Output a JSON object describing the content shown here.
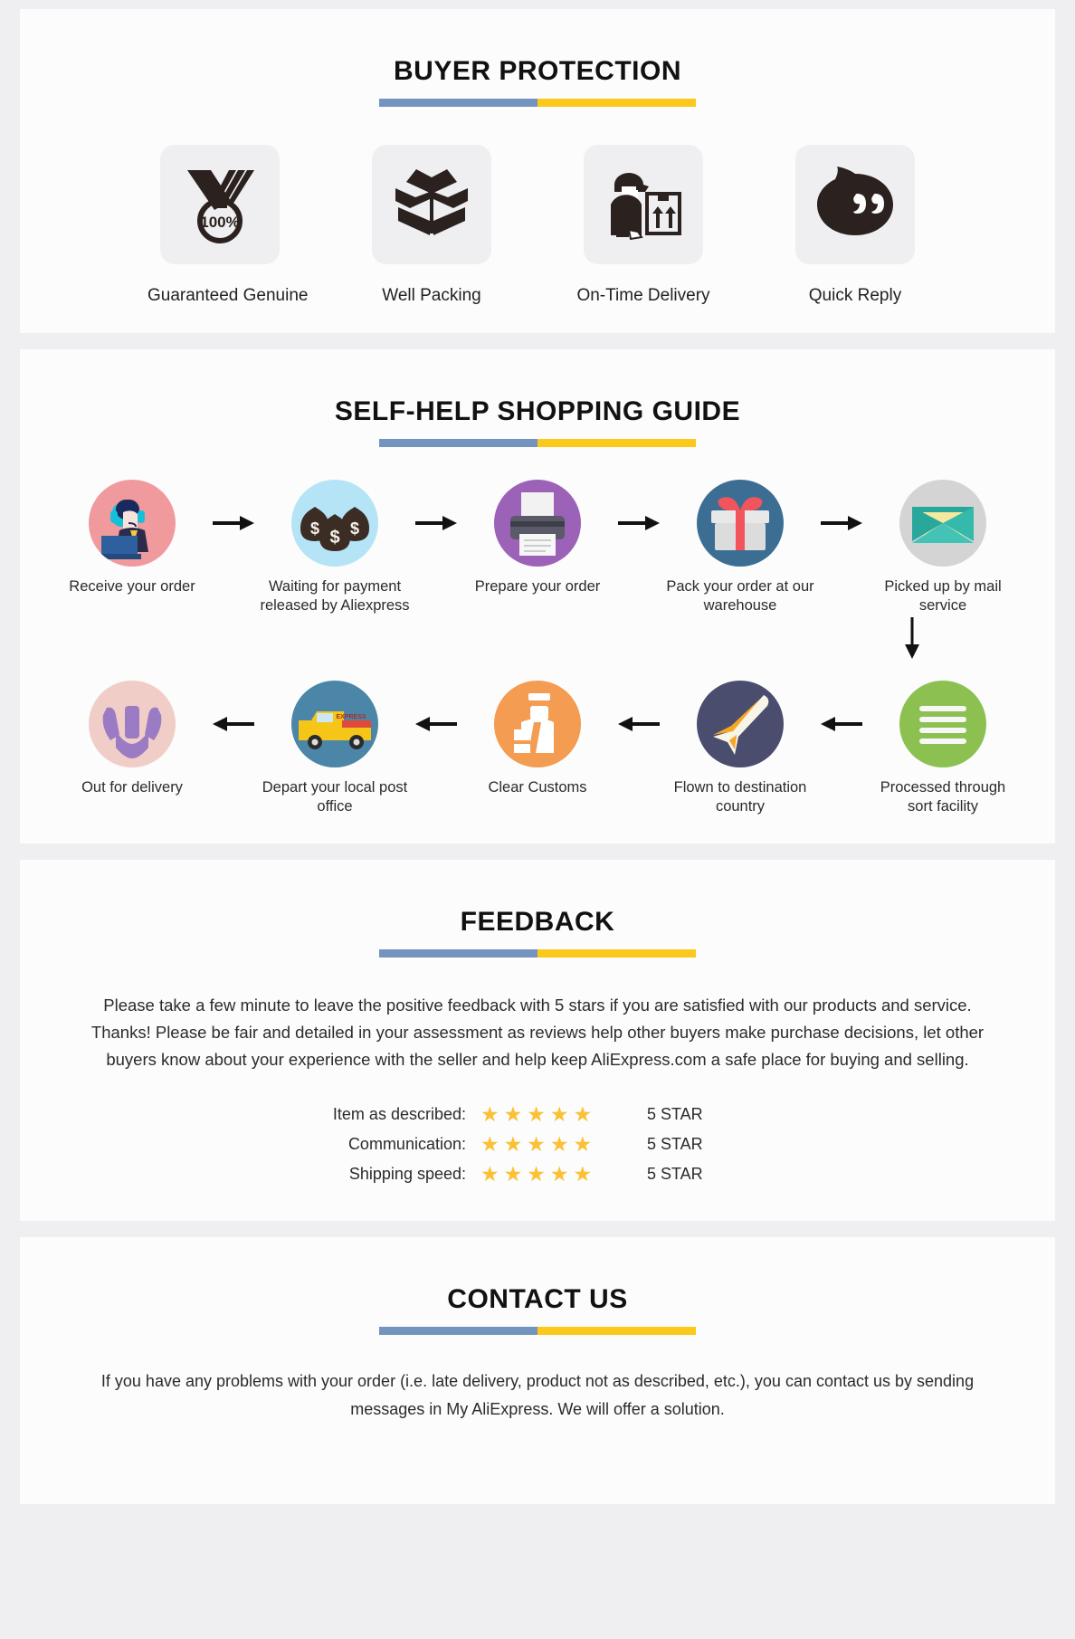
{
  "buyer_protection": {
    "title": "BUYER PROTECTION",
    "items": [
      {
        "label": "Guaranteed Genuine",
        "icon": "medal-100-percent-icon",
        "badge": "100%"
      },
      {
        "label": "Well Packing",
        "icon": "open-box-icon"
      },
      {
        "label": "On-Time Delivery",
        "icon": "delivery-person-box-icon"
      },
      {
        "label": "Quick Reply",
        "icon": "speech-bubble-icon"
      }
    ]
  },
  "shopping_guide": {
    "title": "SELF-HELP SHOPPING GUIDE",
    "row1": [
      {
        "label": "Receive your order",
        "icon": "support-agent-icon",
        "circle": "#f09a9d"
      },
      {
        "label": "Waiting for payment released by Aliexpress",
        "icon": "money-bags-icon",
        "circle": "#b6e4f7"
      },
      {
        "label": "Prepare your order",
        "icon": "printer-icon",
        "circle": "#9b62b8"
      },
      {
        "label": "Pack your order at our warehouse",
        "icon": "gift-box-icon",
        "circle": "#3c6e94"
      },
      {
        "label": "Picked up by mail service",
        "icon": "envelope-icon",
        "circle": "#d4d4d4"
      }
    ],
    "row2": [
      {
        "label": "Out for delivery",
        "icon": "hands-holding-icon",
        "circle": "#f0cdc6"
      },
      {
        "label": "Depart your local post office",
        "icon": "express-van-icon",
        "circle": "#4b86a8"
      },
      {
        "label": "Clear Customs",
        "icon": "customs-officer-icon",
        "circle": "#f39c52"
      },
      {
        "label": "Flown to destination country",
        "icon": "airplane-icon",
        "circle": "#4b4d6e"
      },
      {
        "label": "Processed through sort facility",
        "icon": "sort-facility-icon",
        "circle": "#8cc152"
      }
    ],
    "van_text": "EXPRESS"
  },
  "feedback": {
    "title": "FEEDBACK",
    "paragraph": "Please take a few minute to leave the positive feedback with 5 stars if you are satisfied with our products and service. Thanks! Please be fair and detailed in your assessment as reviews help other buyers make purchase decisions, let other buyers know about your experience with the seller and help keep AliExpress.com a safe place for buying and selling.",
    "ratings": [
      {
        "label": "Item as described:",
        "stars": 5,
        "value": "5 STAR"
      },
      {
        "label": "Communication:",
        "stars": 5,
        "value": "5 STAR"
      },
      {
        "label": "Shipping speed:",
        "stars": 5,
        "value": "5 STAR"
      }
    ]
  },
  "contact": {
    "title": "CONTACT US",
    "paragraph": "If you have any problems with your order (i.e. late delivery, product not as described, etc.), you can contact us by sending messages in My AliExpress. We will offer a solution."
  },
  "colors": {
    "rule_blue": "#7494c0",
    "rule_gold": "#fbc91b",
    "star": "#fbc033",
    "page_bg": "#efeff1",
    "card_bg": "#fcfcfc"
  }
}
